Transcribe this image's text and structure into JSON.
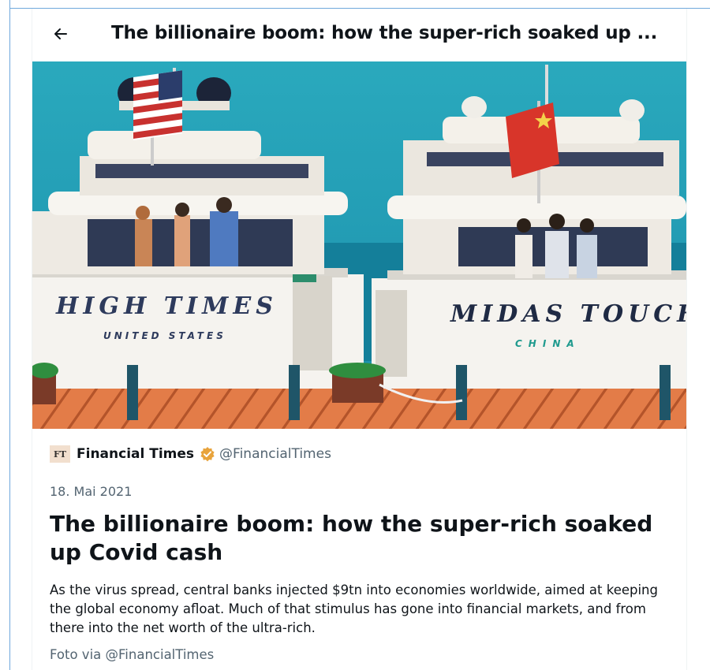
{
  "header": {
    "back_icon": "arrow-left-icon",
    "title": "The billionaire boom: how the super-rich soaked up ..."
  },
  "hero": {
    "alt_icon": "article-illustration",
    "left_yacht": {
      "name": "HIGH TIMES",
      "country": "UNITED STATES"
    },
    "right_yacht": {
      "name": "MIDAS TOUCH",
      "country": "CHINA"
    }
  },
  "article": {
    "source": {
      "logo_text": "FT",
      "name": "Financial Times",
      "verified_icon": "verified-badge-icon",
      "handle": "@FinancialTimes"
    },
    "date": "18. Mai 2021",
    "title": "The billionaire boom: how the super-rich soaked up Covid cash",
    "description": "As the virus spread, central banks injected $9tn into economies worldwide, aimed at keeping the global economy afloat. Much of that stimulus has gone into financial markets, and from there into the net worth of the ultra-rich.",
    "photo_credit": "Foto via @FinancialTimes"
  },
  "colors": {
    "sky": "#1fa0b5",
    "sea": "#147f9a",
    "deck": "#e07a46",
    "verified_gold": "#e8a33b",
    "muted_text": "#536471"
  }
}
